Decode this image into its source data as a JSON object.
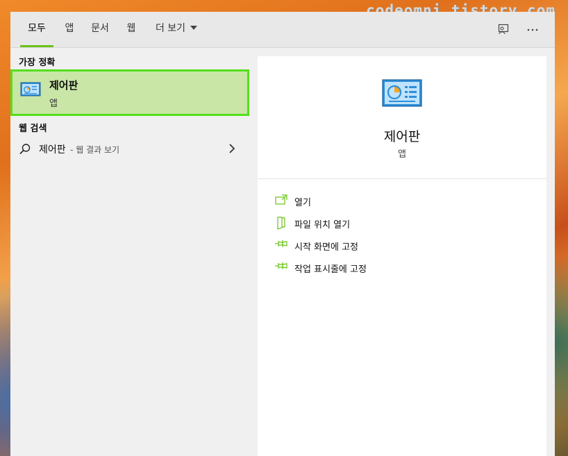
{
  "watermark": "codeomni.tistory.com",
  "tabs": [
    {
      "label": "모두",
      "active": true
    },
    {
      "label": "앱"
    },
    {
      "label": "문서"
    },
    {
      "label": "웹"
    },
    {
      "label": "더 보기"
    }
  ],
  "top_icons": [
    "feedback-icon",
    "more-options-icon"
  ],
  "best_match": {
    "section_label": "가장 정확",
    "name": "제어판",
    "kind": "앱",
    "icon": "control-panel-icon"
  },
  "web_search": {
    "section_label": "웹 검색",
    "query": "제어판",
    "hint": "- 웹 결과 보기"
  },
  "preview": {
    "title": "제어판",
    "subtitle": "앱",
    "actions": [
      {
        "label": "열기",
        "icon": "open-icon"
      },
      {
        "label": "파일 위치 열기",
        "icon": "file-location-icon"
      },
      {
        "label": "시작 화면에 고정",
        "icon": "pin-icon"
      },
      {
        "label": "작업 표시줄에 고정",
        "icon": "pin-icon"
      }
    ]
  },
  "colors": {
    "accent": "#6bc21a",
    "selection_fill": "#c9e6a6",
    "selection_border": "#52e01a"
  }
}
